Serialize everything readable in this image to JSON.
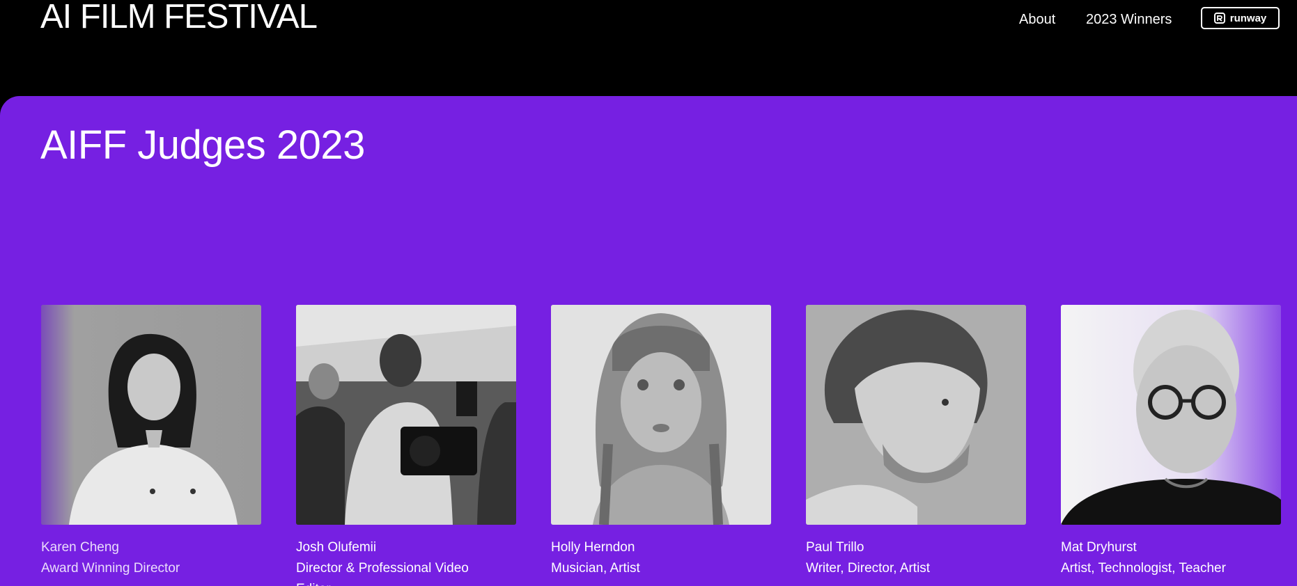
{
  "header": {
    "logo_text": "AI FILM FESTIVAL",
    "nav": [
      {
        "label": "About"
      },
      {
        "label": "2023 Winners"
      }
    ],
    "runway_button": {
      "label": "runway",
      "icon": "runway-logo-icon"
    }
  },
  "main": {
    "title": "AIFF Judges 2023",
    "judges": [
      {
        "name": "Karen Cheng",
        "role": "Award Winning Director"
      },
      {
        "name": "Josh Olufemii",
        "role": "Director & Professional Video Editor"
      },
      {
        "name": "Holly Herndon",
        "role": "Musician, Artist"
      },
      {
        "name": "Paul Trillo",
        "role": "Writer, Director, Artist"
      },
      {
        "name": "Mat Dryhurst",
        "role": "Artist, Technologist, Teacher"
      }
    ]
  },
  "colors": {
    "background": "#000000",
    "panel": "#7620e2",
    "text": "#ffffff"
  }
}
